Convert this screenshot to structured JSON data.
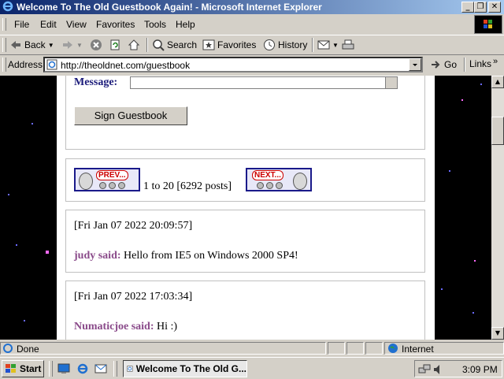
{
  "window": {
    "title": "Welcome To The Old Guestbook Again! - Microsoft Internet Explorer",
    "buttons": [
      "minimize",
      "restore",
      "close"
    ]
  },
  "menu": [
    "File",
    "Edit",
    "View",
    "Favorites",
    "Tools",
    "Help"
  ],
  "toolbar": {
    "back": "Back",
    "search": "Search",
    "favorites": "Favorites",
    "history": "History"
  },
  "address": {
    "label": "Address",
    "url": "http://theoldnet.com/guestbook",
    "go": "Go",
    "links": "Links"
  },
  "page": {
    "message_label": "Message:",
    "sign_button": "Sign Guestbook",
    "prev_label": "PREV...",
    "next_label": "NEXT...",
    "pagination": "1 to 20 [6292 posts]",
    "entries": [
      {
        "timestamp": "[Fri Jan 07 2022 20:09:57]",
        "author": "judy said:",
        "text": "Hello from IE5 on Windows 2000 SP4!"
      },
      {
        "timestamp": "[Fri Jan 07 2022 17:03:34]",
        "author": "Numaticjoe said:",
        "text": "Hi :)"
      }
    ]
  },
  "status": {
    "text": "Done",
    "zone": "Internet"
  },
  "taskbar": {
    "start": "Start",
    "task": "Welcome To The Old G...",
    "clock": "3:09 PM"
  },
  "colors": {
    "title_start": "#0a246a",
    "title_end": "#a6caf0",
    "author": "#8a4a8a",
    "label": "#1a1a7a"
  }
}
